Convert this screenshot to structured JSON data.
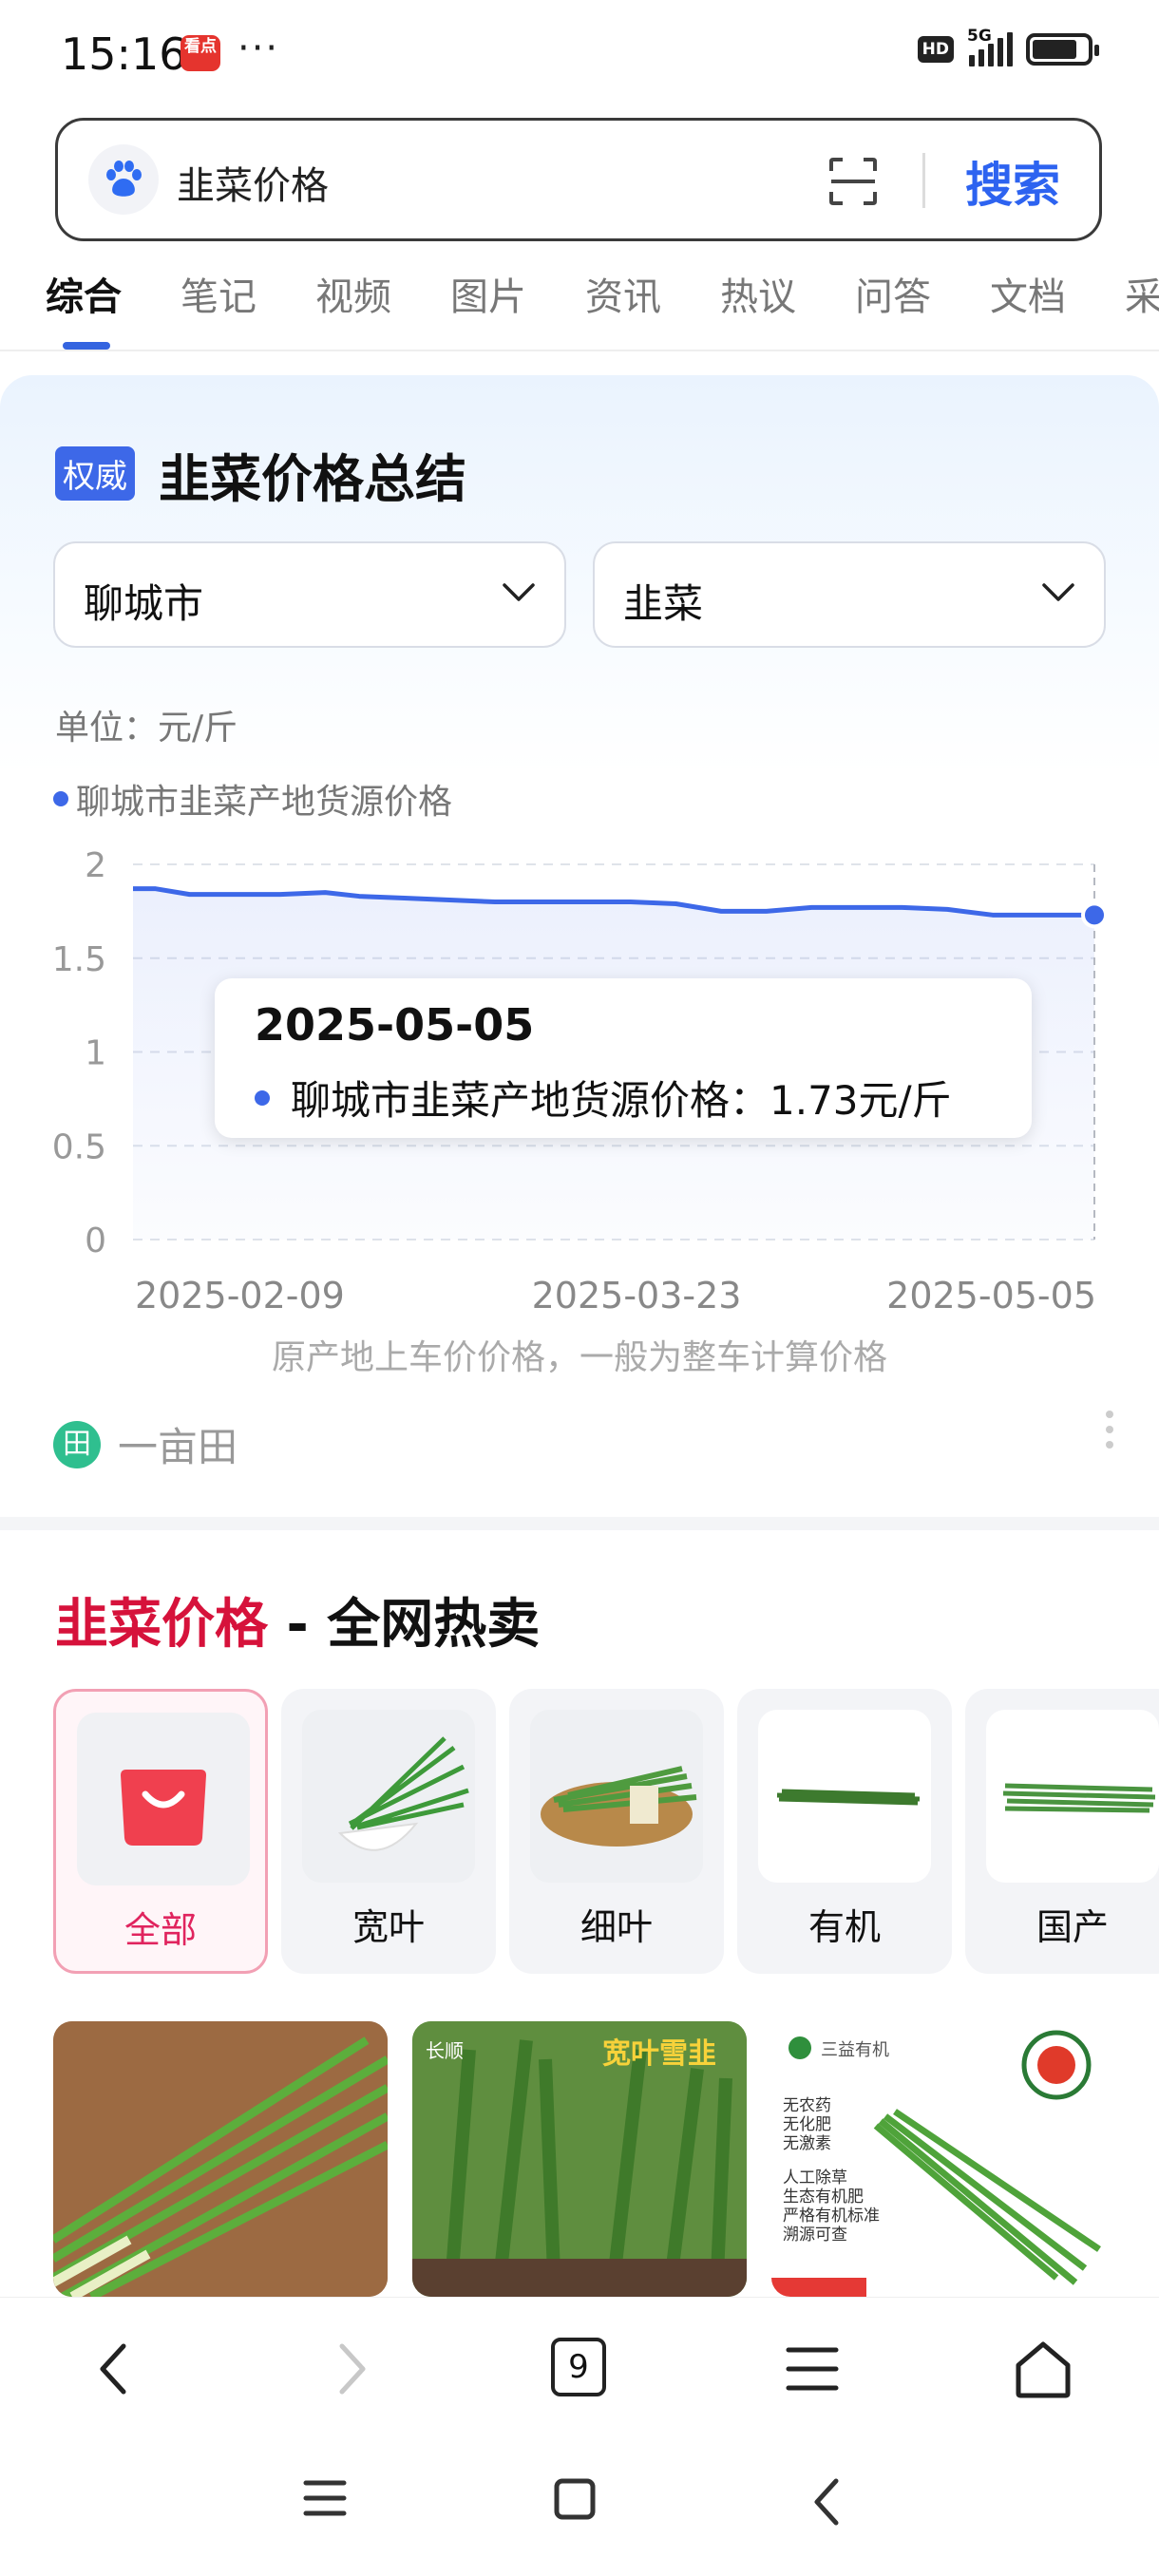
{
  "status_bar": {
    "time": "15:16",
    "app_icon_text": "看点",
    "more": "···",
    "hd": "HD",
    "network": "5G"
  },
  "search": {
    "query": "韭菜价格",
    "button_label": "搜索"
  },
  "tabs": [
    {
      "label": "综合",
      "active": true
    },
    {
      "label": "笔记"
    },
    {
      "label": "视频"
    },
    {
      "label": "图片"
    },
    {
      "label": "资讯"
    },
    {
      "label": "热议"
    },
    {
      "label": "问答"
    },
    {
      "label": "文档"
    },
    {
      "label": "采"
    }
  ],
  "price_card": {
    "badge": "权威",
    "title": "韭菜价格总结",
    "city_select": "聊城市",
    "product_select": "韭菜",
    "unit": "单位：元/斤",
    "series_name": "聊城市韭菜产地货源价格",
    "note": "原产地上车价价格，一般为整车计算价格",
    "source": "一亩田",
    "tooltip": {
      "date": "2025-05-05",
      "series": "聊城市韭菜产地货源价格",
      "value_text": "：1.73元/斤"
    }
  },
  "chart_data": {
    "type": "line",
    "x_tick_labels": [
      "2025-02-09",
      "2025-03-23",
      "2025-05-05"
    ],
    "y_tick_labels": [
      "2",
      "1.5",
      "1",
      "0.5",
      "0"
    ],
    "ylim": [
      0,
      2
    ],
    "grid": true,
    "series": [
      {
        "name": "聊城市韭菜产地货源价格",
        "color": "#3d68e8",
        "x": [
          "2025-02-09",
          "2025-02-11",
          "2025-02-14",
          "2025-02-18",
          "2025-02-22",
          "2025-02-26",
          "2025-03-01",
          "2025-03-05",
          "2025-03-09",
          "2025-03-13",
          "2025-03-17",
          "2025-03-21",
          "2025-03-25",
          "2025-03-29",
          "2025-04-02",
          "2025-04-06",
          "2025-04-10",
          "2025-04-14",
          "2025-04-18",
          "2025-04-22",
          "2025-04-26",
          "2025-04-30",
          "2025-05-05"
        ],
        "values": [
          1.87,
          1.87,
          1.84,
          1.84,
          1.84,
          1.85,
          1.83,
          1.82,
          1.81,
          1.8,
          1.8,
          1.8,
          1.8,
          1.79,
          1.75,
          1.75,
          1.77,
          1.77,
          1.77,
          1.76,
          1.73,
          1.73,
          1.73
        ]
      }
    ]
  },
  "hot_section": {
    "title_highlight": "韭菜价格",
    "title_rest": " - 全网热卖",
    "categories": [
      {
        "label": "全部",
        "active": true
      },
      {
        "label": "宽叶"
      },
      {
        "label": "细叶"
      },
      {
        "label": "有机"
      },
      {
        "label": "国产"
      }
    ],
    "products": [
      {
        "badge": ""
      },
      {
        "brand": "长顺",
        "badge": "宽叶雪韭"
      },
      {
        "brand": "三益有机",
        "lines": [
          "无农药",
          "无化肥",
          "无激素",
          "人工除草",
          "生态有机肥",
          "严格有机标准",
          "溯源可查"
        ]
      }
    ]
  },
  "bottom_nav": {
    "tab_count": "9"
  }
}
